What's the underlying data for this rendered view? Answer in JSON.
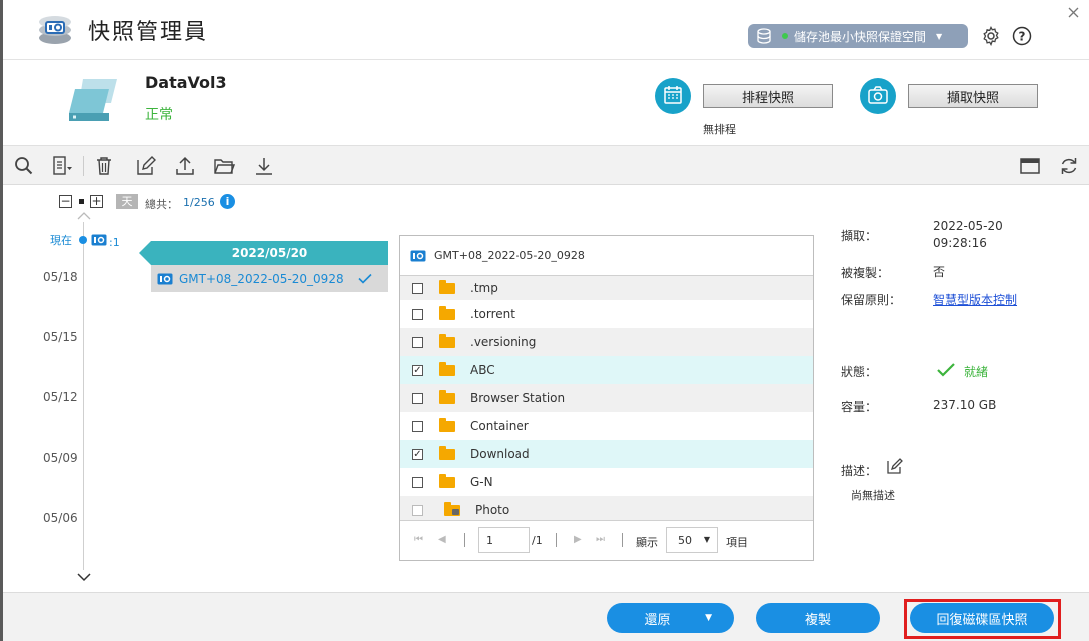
{
  "window": {
    "title": "快照管理員"
  },
  "pool_button": {
    "label": "儲存池最小快照保證空間"
  },
  "volume": {
    "name": "DataVol3",
    "status": "正常"
  },
  "actions": {
    "schedule_label": "排程快照",
    "schedule_status": "無排程",
    "take_label": "擷取快照"
  },
  "timeline": {
    "day_unit": "天",
    "total_label": "總共：",
    "total_value": "1/256",
    "now_label": "現在",
    "now_count": ":1",
    "dates": [
      "05/18",
      "05/15",
      "05/12",
      "05/09",
      "05/06"
    ]
  },
  "snapshot_group": {
    "date": "2022/05/20",
    "items": [
      {
        "name": "GMT+08_2022-05-20_0928",
        "checked": true
      }
    ]
  },
  "file_panel": {
    "title": "GMT+08_2022-05-20_0928",
    "rows": [
      {
        "name": ".tmp",
        "checked": false
      },
      {
        "name": ".torrent",
        "checked": false
      },
      {
        "name": ".versioning",
        "checked": false
      },
      {
        "name": "ABC",
        "checked": true
      },
      {
        "name": "Browser Station",
        "checked": false
      },
      {
        "name": "Container",
        "checked": false
      },
      {
        "name": "Download",
        "checked": true
      },
      {
        "name": "G-N",
        "checked": false
      },
      {
        "name": "Photo",
        "checked": false
      }
    ],
    "pager": {
      "page": "1",
      "total_pages": "/1",
      "show_label": "顯示",
      "per_page": "50",
      "items_label": "項目"
    }
  },
  "info": {
    "taken_label": "擷取：",
    "taken_date": "2022-05-20",
    "taken_time": "09:28:16",
    "replicated_label": "被複製：",
    "replicated_value": "否",
    "retention_label": "保留原則：",
    "retention_value": "智慧型版本控制",
    "status_label": "狀態：",
    "status_value": "就緒",
    "capacity_label": "容量：",
    "capacity_value": "237.10 GB",
    "desc_label": "描述：",
    "desc_value": "尚無描述"
  },
  "footer": {
    "restore_label": "還原",
    "copy_label": "複製",
    "revert_label": "回復磁碟區快照"
  },
  "colors": {
    "accent": "#18a2c9",
    "primary_button": "#1a8fe3",
    "status_ok": "#3db43d",
    "highlight": "#e01e1e"
  }
}
